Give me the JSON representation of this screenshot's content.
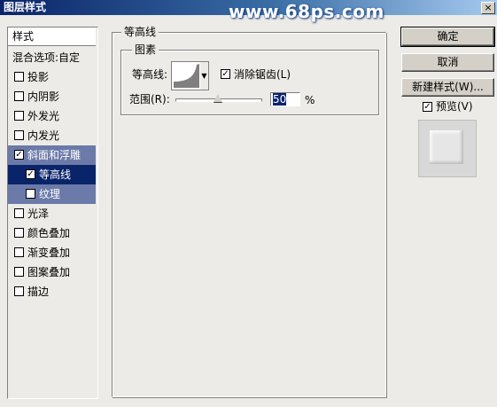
{
  "window": {
    "title": "图层样式",
    "watermark": "www.68ps.com",
    "close_label": "×"
  },
  "left_panel": {
    "header": "样式",
    "blend_options": "混合选项:自定",
    "items": [
      {
        "label": "投影",
        "checked": false
      },
      {
        "label": "内阴影",
        "checked": false
      },
      {
        "label": "外发光",
        "checked": false
      },
      {
        "label": "内发光",
        "checked": false
      },
      {
        "label": "斜面和浮雕",
        "checked": true
      },
      {
        "label": "等高线",
        "checked": true
      },
      {
        "label": "纹理",
        "checked": false
      },
      {
        "label": "光泽",
        "checked": false
      },
      {
        "label": "颜色叠加",
        "checked": false
      },
      {
        "label": "渐变叠加",
        "checked": false
      },
      {
        "label": "图案叠加",
        "checked": false
      },
      {
        "label": "描边",
        "checked": false
      }
    ]
  },
  "main": {
    "group_title": "等高线",
    "subgroup_title": "图素",
    "contour_label": "等高线:",
    "anti_alias_label": "消除锯齿(L)",
    "anti_alias_checked": true,
    "range_label": "范围(R):",
    "range_value": "50",
    "range_unit": "%",
    "range_level": 0.5
  },
  "buttons": {
    "ok": "确定",
    "cancel": "取消",
    "new_style": "新建样式(W)...",
    "preview_label": "预览(V)",
    "preview_checked": true
  }
}
